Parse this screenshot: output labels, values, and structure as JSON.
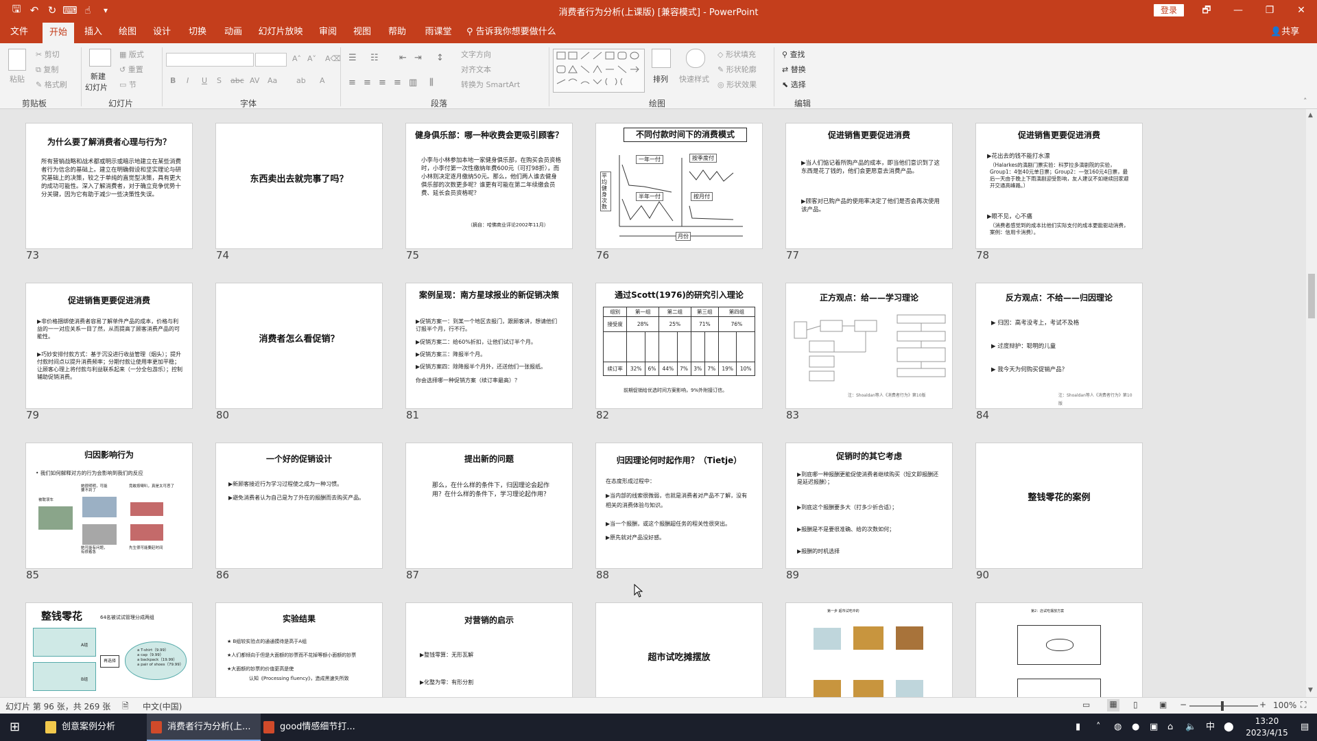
{
  "window": {
    "title": "消费者行为分析(上课版) [兼容模式] - PowerPoint",
    "login": "登录",
    "controls": {
      "restore": "🗗",
      "minimize": "—",
      "maximize": "❐",
      "close": "✕"
    }
  },
  "quick_access": {
    "save": "🖫",
    "undo": "↶",
    "redo": "↻",
    "present": "⌨",
    "touch": "☝",
    "more": "▾"
  },
  "tabs": [
    "文件",
    "开始",
    "插入",
    "绘图",
    "设计",
    "切换",
    "动画",
    "幻灯片放映",
    "审阅",
    "视图",
    "帮助",
    "雨课堂"
  ],
  "active_tab": "开始",
  "tell_me": "告诉我你想要做什么",
  "share": "共享",
  "ribbon": {
    "groups": {
      "clipboard": "剪贴板",
      "slides": "幻灯片",
      "font": "字体",
      "paragraph": "段落",
      "drawing": "绘图",
      "editing": "编辑"
    },
    "clipboard": {
      "paste": "粘贴",
      "cut": "剪切",
      "copy": "复制",
      "format_painter": "格式刷"
    },
    "slides": {
      "new_slide_1": "新建",
      "new_slide_2": "幻灯片",
      "layout": "版式",
      "reset": "重置",
      "section": "节"
    },
    "font": {
      "bold": "B",
      "italic": "I",
      "underline": "U",
      "strike": "S",
      "shadow": "abc",
      "spacing": "AV",
      "case": "Aa",
      "color": "A",
      "grow": "A˄",
      "shrink": "A˅",
      "clear": "A⌫",
      "highlight": "ab"
    },
    "paragraph": {
      "text_direction": "文字方向",
      "align_text": "对齐文本",
      "smartart": "转换为 SmartArt"
    },
    "drawing": {
      "arrange": "排列",
      "quick_styles": "快速样式",
      "shape_fill": "形状填充",
      "shape_outline": "形状轮廓",
      "shape_effects": "形状效果"
    },
    "editing": {
      "find": "查找",
      "replace": "替换",
      "select": "选择"
    }
  },
  "slides": [
    {
      "num": "73",
      "title": "为什么要了解消费者心理与行为？",
      "body": "所有营销战略和战术都或明示或暗示地建立在某些消费者行为信念的基础上。建立在明确假设和坚实理论与研究基础上的决策，较之于单纯的直觉型决策，具有更大的成功可能性。深入了解消费者，对于确立竞争优势十分关键，因为它有助于减少一些决策性失误。"
    },
    {
      "num": "74",
      "center": "东西卖出去就完事了吗？"
    },
    {
      "num": "75",
      "title": "健身俱乐部：哪一种收费会更吸引顾客？",
      "body": "小李与小林参加本地一家健身俱乐部，在购买会员资格时，小李付第一次性缴纳年费600元（可打98折），而小林则决定逐月缴纳50元。那么，他们两人谁去健身俱乐部的次数更多呢？谁更有可能在第二年续缴会员费、延长会员资格呢？",
      "note": "（摘自：哈佛商业评论2002年11月）"
    },
    {
      "num": "76",
      "title": "不同付款时间下的消费模式",
      "labels": [
        "一年一付",
        "按季度付",
        "半年一付",
        "按月付",
        "月份",
        "平均健身次数"
      ]
    },
    {
      "num": "77",
      "title": "促进销售更要促进消费",
      "bullets": [
        "▶当人们惦记着所购产品的成本，即当他们意识到了这东西是花了钱的，他们会更愿意去消费产品。",
        "▶顾客对已购产品的使用率决定了他们是否会再次使用该产品。"
      ]
    },
    {
      "num": "78",
      "title": "促进销售更要促进消费",
      "bullets": [
        "▶花出去的钱不能打水漂",
        "（Halarkes的演剧门票实验：科罗拉多演剧院的实验，Group1：4张40元单日票；Group2：一张160元4日票，最后一天由于晚上下雨演剧迎受影响，友人建议不如继续回家避开交通高峰路。）",
        "▶眼不见，心不痛",
        "（消费者感觉到的成本比他们实际支付的成本更能驱动消费，案例：信用卡消费）。"
      ]
    },
    {
      "num": "79",
      "title": "促进销售更要促进消费",
      "bullets": [
        "▶非价格捆绑使消费者容易了解单件产品的成本，价格与利益的一一对应关系一目了然，从而提高了顾客消费产品的可能性。",
        "▶巧妙安排付款方式：基于沉没进行收益管理（烟头）；提升付款时间点以提升消费频率；分期付款让使用率更加平稳；让顾客心理上将付款与利益联系起来（一分全包游乐）；控制辅助促销消费。"
      ]
    },
    {
      "num": "80",
      "center": "消费者怎么看促销？"
    },
    {
      "num": "81",
      "title": "案例呈现：南方星球报业的新促销决策",
      "bullets": [
        "▶促销方案一：到某一个地区去报门，跟顾客讲，想请他们订报半个月，行不行。",
        "▶促销方案二：给60%折扣，让他们试订半个月。",
        "▶促销方案三：降报半个月。",
        "▶促销方案四：除降报半个月外，还送他们一张报纸。",
        "你会选择哪一种促销方案（续订率最高）？"
      ]
    },
    {
      "num": "82",
      "title": "通过Scott(1976)的研究引入理论",
      "table_head": [
        "组别",
        "第一组",
        "第二组",
        "第三组",
        "第四组"
      ],
      "row1_label": "接受度",
      "row1": [
        "28%",
        "25%",
        "71%",
        "76%"
      ],
      "row2_label": "续订率",
      "row2": [
        "32%",
        "6%",
        "44%",
        "7%",
        "3%",
        "7%",
        "19%",
        "10%"
      ],
      "caption": "前期促销给优选时间方案影响，9%外附接订信。"
    },
    {
      "num": "83",
      "title": "正方观点：给——学习理论",
      "note": "注：Shoaldan等人《消费者行为》第10版"
    },
    {
      "num": "84",
      "title": "反方观点：不给——归因理论",
      "bullets": [
        "▶ 归因：高考没考上，考试不及格",
        "▶ 过度辩护：聪明的儿童",
        "▶ 我今天为何购买促销产品？"
      ],
      "note": "注：Shoaldan等人《消费者行为》第10版"
    },
    {
      "num": "85",
      "title": "归因影响行为",
      "bullets": [
        "• 我们如何解释对方的行为会影响到我们的反应"
      ],
      "labels": [
        "被耽误车",
        "她很明明，可能要不到了",
        "竟敢按喇叭，真是太可恶了",
        "她可能有问题，有很着急",
        "先生很可能要赶时间"
      ]
    },
    {
      "num": "86",
      "title": "一个好的促销设计",
      "bullets": [
        "▶新顾客接近行为学习过程使之成为一种习惯。",
        "▶避免消费者认为自己是为了外在的报酬而去购买产品。"
      ]
    },
    {
      "num": "87",
      "title": "提出新的问题",
      "body": "那么，在什么样的条件下，归因理论会起作用？在什么样的条件下，学习理论起作用？"
    },
    {
      "num": "88",
      "title": "归因理论何时起作用？（Tietje）",
      "bullets": [
        "在态度形成过程中：",
        "▶当内部的线索很微弱，也就是消费者对产品不了解，没有相关的消费体验与知识。",
        "▶当一个报酬，或这个报酬超任务的程关性很突出。",
        "▶原先就对产品没好感。"
      ]
    },
    {
      "num": "89",
      "title": "促销时的其它考虑",
      "bullets": [
        "▶到底哪一种报酬更能促使消费者继续购买（短文即报酬还是延迟报酬）；",
        "▶到底这个报酬要多大（打多少折合适）；",
        "▶报酬是不是要很准确、给的次数如何；",
        "▶报酬的时机选择"
      ]
    },
    {
      "num": "90",
      "center": "整钱零花的案例"
    },
    {
      "num": "91",
      "title": "整钱零花",
      "subtitle": "64名被试试管理分成两组",
      "labels": [
        "A组",
        "B组",
        "再选择"
      ],
      "items": [
        "a T-shirt（9.99）",
        "a cap（9.99）",
        "a backpack（19.99）",
        "a pair of shoes（79.99）"
      ]
    },
    {
      "num": "92",
      "title": "实验结果",
      "bullets": [
        "★ B组较实验点的通通摸待是高于A组",
        "★人们都倾向于但是大面额的钞票而不花掉等额小面额的钞票",
        "★大面额的钞票的价值更高是使",
        "认知《Processing fluency》，造成黑速失所致"
      ]
    },
    {
      "num": "93",
      "title": "对营销的启示",
      "bullets": [
        "▶整钱零算：无形瓦解",
        "▶化整为零：有形分割"
      ]
    },
    {
      "num": "94",
      "center": "超市试吃摊摆放"
    },
    {
      "num": "95",
      "header": "第一步 超市试吃中的"
    },
    {
      "num": "96",
      "header": "第2：店试吃摆放方案"
    }
  ],
  "status": {
    "slide_info": "幻灯片 第 96 张，共 269 张",
    "language": "中文(中国)",
    "zoom": "100%"
  },
  "taskbar": {
    "items": [
      {
        "label": "创意案例分析"
      },
      {
        "label": "消费者行为分析(上...",
        "active": true
      },
      {
        "label": "good情感细节打..."
      }
    ],
    "time": "13:20",
    "date": "2023/4/15",
    "ime": "中"
  }
}
